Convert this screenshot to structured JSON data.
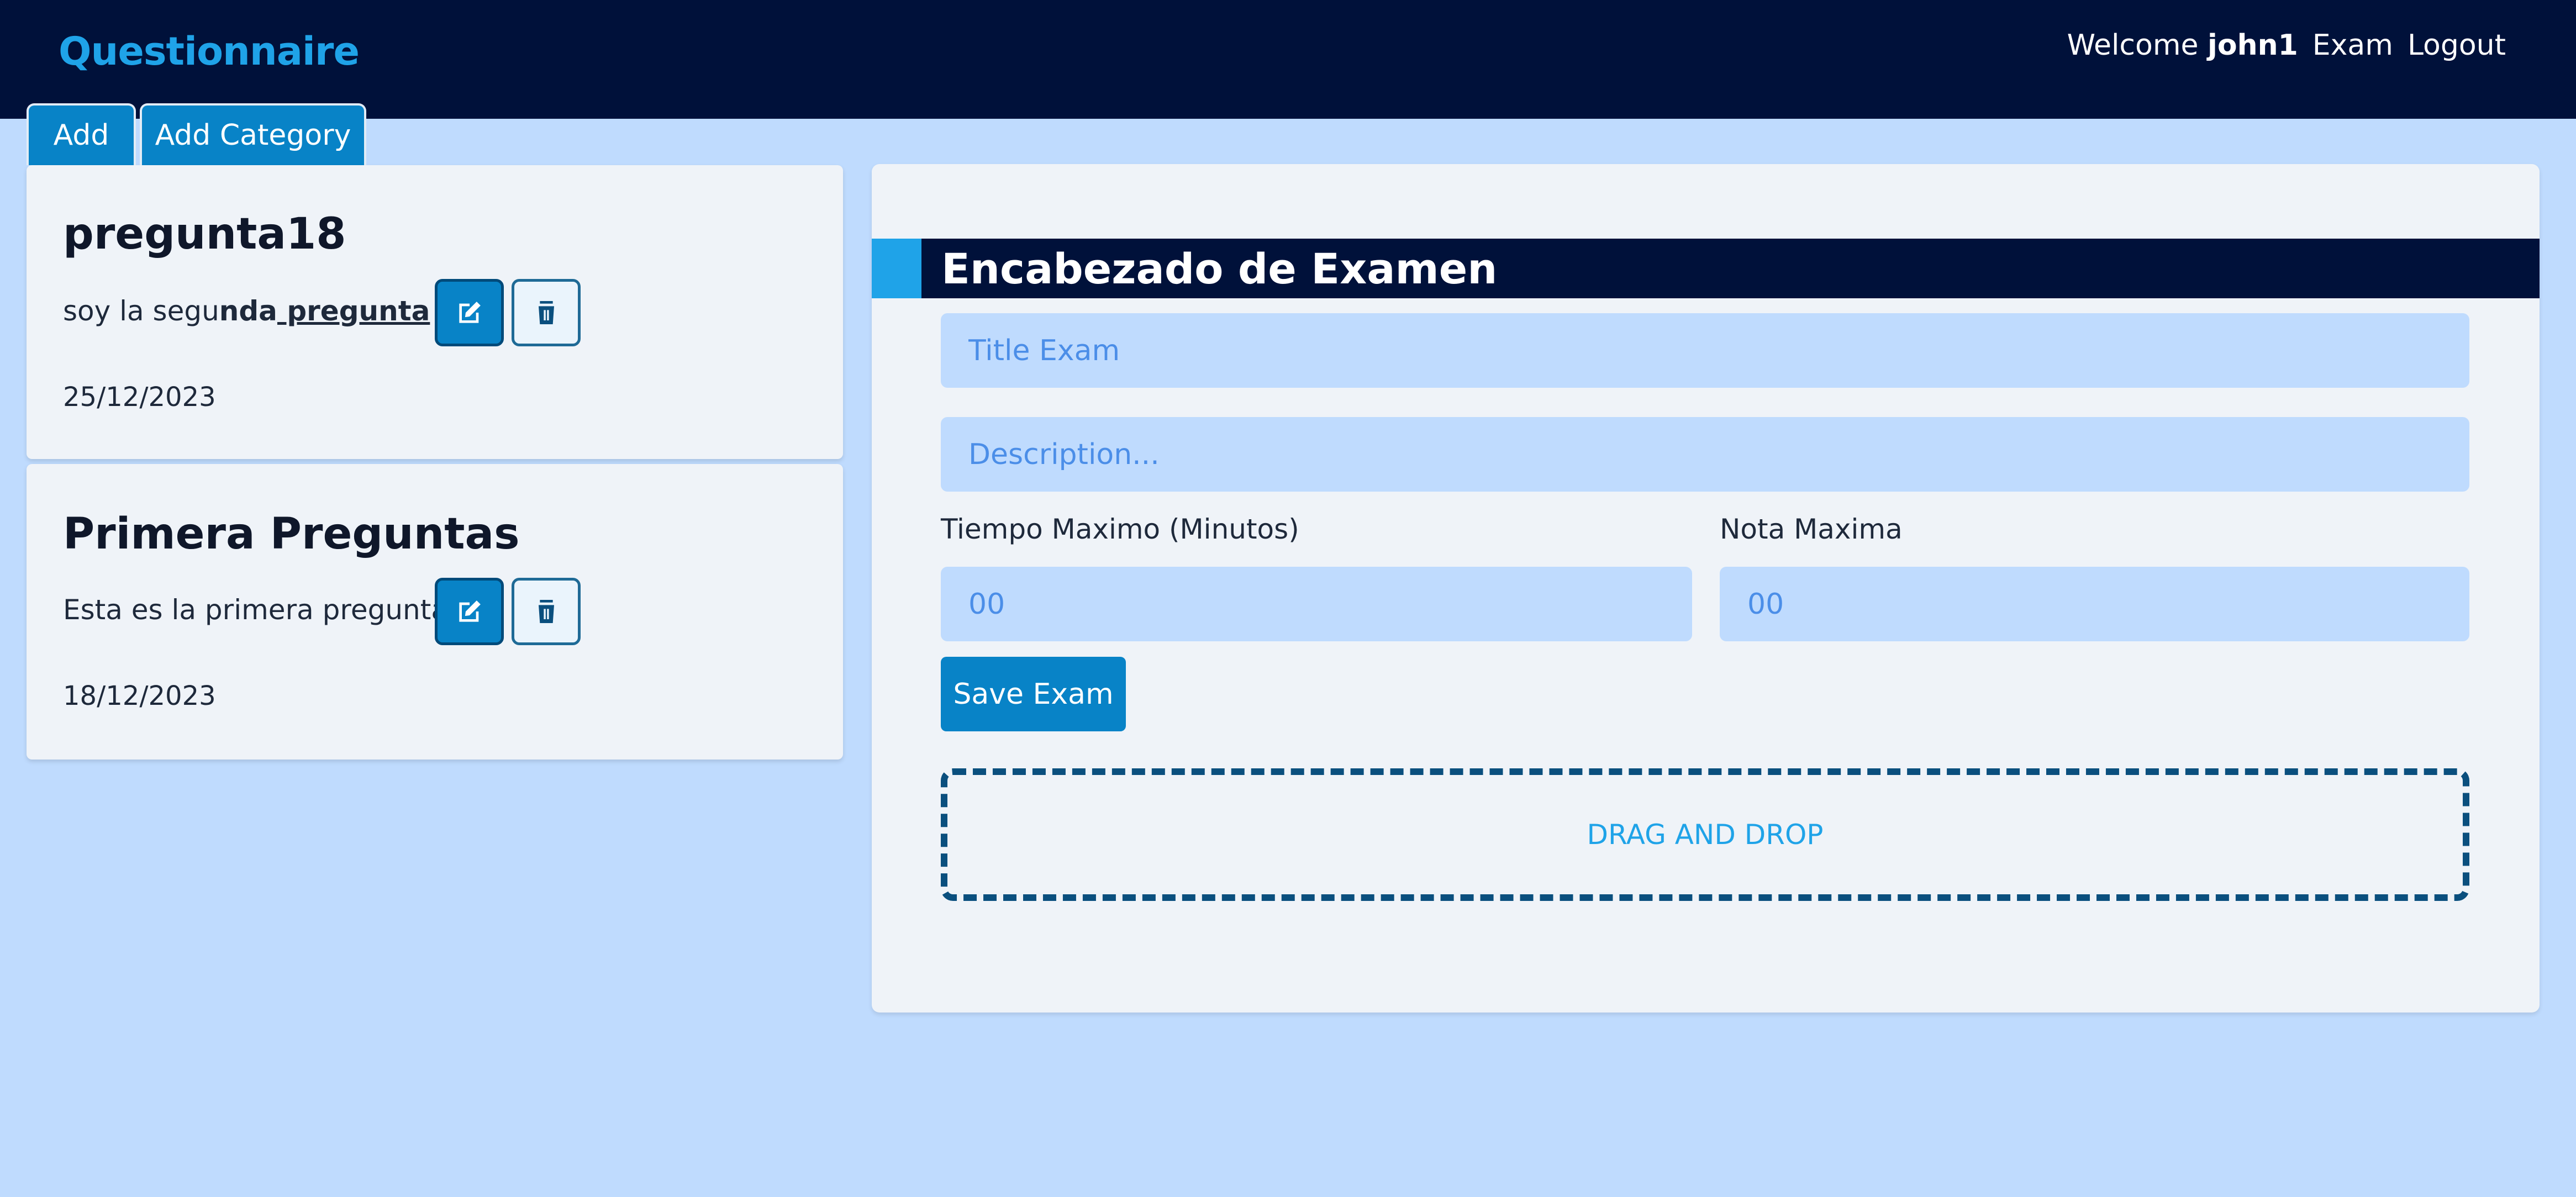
{
  "navbar": {
    "brand": "Questionnaire",
    "welcome_label": "Welcome",
    "username": "john1",
    "exam_link": "Exam",
    "logout_link": "Logout"
  },
  "tabs": {
    "add": "Add",
    "add_category": "Add Category"
  },
  "questions": [
    {
      "title": "pregunta18",
      "description_parts": [
        "soy la segu",
        "nda",
        " pregunta"
      ],
      "date": "25/12/2023"
    },
    {
      "title": "Primera Preguntas",
      "description": "Esta es la primera pregunta",
      "date": "18/12/2023"
    }
  ],
  "exam_panel": {
    "header": "Encabezado de Examen",
    "title_placeholder": "Title Exam",
    "description_placeholder": "Description...",
    "time_label": "Tiempo Maximo (Minutos)",
    "time_placeholder": "00",
    "grade_label": "Nota Maxima",
    "grade_placeholder": "00",
    "save_button": "Save Exam",
    "dropzone_text": "DRAG AND DROP"
  },
  "colors": {
    "navbar_bg": "#00113a",
    "brand": "#1fa3e8",
    "page_bg": "#bfdbfe",
    "primary_button": "#0883c7"
  },
  "icons": {
    "edit": "edit-icon",
    "delete": "trash-icon"
  }
}
